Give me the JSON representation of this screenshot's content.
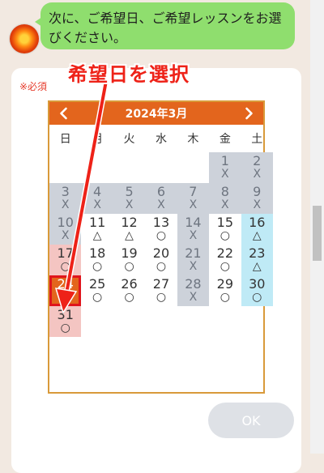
{
  "chat": {
    "message": "次に、ご希望日、ご希望レッスンをお選びください。"
  },
  "annotation": {
    "text": "希望日を選択",
    "color": "#ee2218"
  },
  "form": {
    "required_label": "※必須",
    "ok_label": "OK"
  },
  "calendar": {
    "title": "2024年3月",
    "prev_icon": "chevron-left-icon",
    "next_icon": "chevron-right-icon",
    "weekdays": [
      "日",
      "月",
      "火",
      "水",
      "木",
      "金",
      "土"
    ],
    "days": [
      {
        "day": "",
        "mark": "",
        "status": "empty"
      },
      {
        "day": "",
        "mark": "",
        "status": "empty"
      },
      {
        "day": "",
        "mark": "",
        "status": "empty"
      },
      {
        "day": "",
        "mark": "",
        "status": "empty"
      },
      {
        "day": "",
        "mark": "",
        "status": "empty"
      },
      {
        "day": "1",
        "mark": "X",
        "status": "closed"
      },
      {
        "day": "2",
        "mark": "X",
        "status": "closed"
      },
      {
        "day": "3",
        "mark": "X",
        "status": "closed"
      },
      {
        "day": "4",
        "mark": "X",
        "status": "closed"
      },
      {
        "day": "5",
        "mark": "X",
        "status": "closed"
      },
      {
        "day": "6",
        "mark": "X",
        "status": "closed"
      },
      {
        "day": "7",
        "mark": "X",
        "status": "closed"
      },
      {
        "day": "8",
        "mark": "X",
        "status": "closed"
      },
      {
        "day": "9",
        "mark": "X",
        "status": "closed"
      },
      {
        "day": "10",
        "mark": "X",
        "status": "closed"
      },
      {
        "day": "11",
        "mark": "△",
        "status": "open"
      },
      {
        "day": "12",
        "mark": "△",
        "status": "open"
      },
      {
        "day": "13",
        "mark": "○",
        "status": "open"
      },
      {
        "day": "14",
        "mark": "X",
        "status": "closed"
      },
      {
        "day": "15",
        "mark": "○",
        "status": "open"
      },
      {
        "day": "16",
        "mark": "△",
        "status": "sat"
      },
      {
        "day": "17",
        "mark": "○",
        "status": "sun"
      },
      {
        "day": "18",
        "mark": "○",
        "status": "open"
      },
      {
        "day": "19",
        "mark": "○",
        "status": "open"
      },
      {
        "day": "20",
        "mark": "○",
        "status": "open"
      },
      {
        "day": "21",
        "mark": "X",
        "status": "closed"
      },
      {
        "day": "22",
        "mark": "○",
        "status": "open"
      },
      {
        "day": "23",
        "mark": "△",
        "status": "sat"
      },
      {
        "day": "24",
        "mark": "○",
        "status": "selected"
      },
      {
        "day": "25",
        "mark": "○",
        "status": "open"
      },
      {
        "day": "26",
        "mark": "○",
        "status": "open"
      },
      {
        "day": "27",
        "mark": "○",
        "status": "open"
      },
      {
        "day": "28",
        "mark": "X",
        "status": "closed"
      },
      {
        "day": "29",
        "mark": "○",
        "status": "open"
      },
      {
        "day": "30",
        "mark": "○",
        "status": "sat"
      },
      {
        "day": "31",
        "mark": "○",
        "status": "sun"
      }
    ]
  }
}
